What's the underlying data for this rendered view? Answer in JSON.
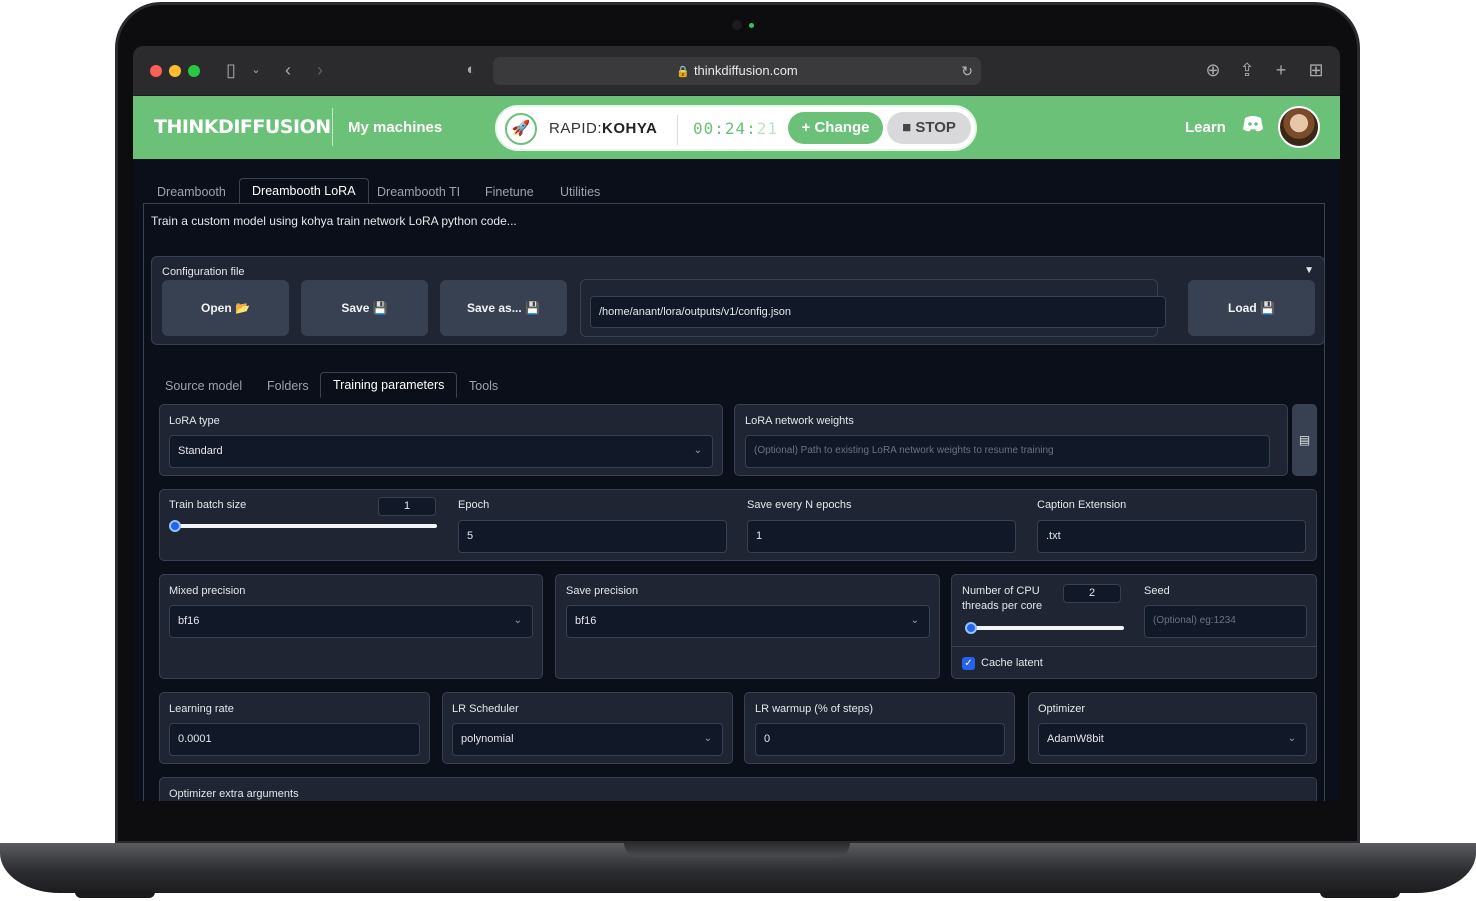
{
  "browser": {
    "url": "thinkdiffusion.com"
  },
  "header": {
    "logo": "THINKDIFFUSION",
    "my_machines": "My machines",
    "machine_prefix": "RAPID:",
    "machine_name": "KOHYA",
    "timer_main": "00:24:",
    "timer_seconds": "21",
    "change_label": "Change",
    "stop_label": "STOP",
    "learn_label": "Learn"
  },
  "tabs": [
    "Dreambooth",
    "Dreambooth LoRA",
    "Dreambooth TI",
    "Finetune",
    "Utilities"
  ],
  "active_tab": "Dreambooth LoRA",
  "description": "Train a custom model using kohya train network LoRA python code...",
  "config": {
    "label": "Configuration file",
    "open_label": "Open 📂",
    "save_label": "Save 💾",
    "save_as_label": "Save as... 💾",
    "path": "/home/anant/lora/outputs/v1/config.json",
    "load_label": "Load 💾"
  },
  "subtabs": [
    "Source model",
    "Folders",
    "Training parameters",
    "Tools"
  ],
  "active_subtab": "Training parameters",
  "params": {
    "lora_type_label": "LoRA type",
    "lora_type_value": "Standard",
    "lora_weights_label": "LoRA network weights",
    "lora_weights_placeholder": "(Optional) Path to existing LoRA network weights to resume training",
    "batch_label": "Train batch size",
    "batch_value": "1",
    "epoch_label": "Epoch",
    "epoch_value": "5",
    "save_every_label": "Save every N epochs",
    "save_every_value": "1",
    "caption_ext_label": "Caption Extension",
    "caption_ext_value": ".txt",
    "mixed_precision_label": "Mixed precision",
    "mixed_precision_value": "bf16",
    "save_precision_label": "Save precision",
    "save_precision_value": "bf16",
    "cpu_threads_label": "Number of CPU threads per core",
    "cpu_threads_value": "2",
    "seed_label": "Seed",
    "seed_placeholder": "(Optional) eg:1234",
    "cache_latent_label": "Cache latent",
    "learning_rate_label": "Learning rate",
    "learning_rate_value": "0.0001",
    "lr_scheduler_label": "LR Scheduler",
    "lr_scheduler_value": "polynomial",
    "lr_warmup_label": "LR warmup (% of steps)",
    "lr_warmup_value": "0",
    "optimizer_label": "Optimizer",
    "optimizer_value": "AdamW8bit",
    "optimizer_extra_label": "Optimizer extra arguments"
  },
  "colors": {
    "brand_green": "#6ac177",
    "background": "#0b0f19",
    "accent_blue": "#2563eb"
  }
}
